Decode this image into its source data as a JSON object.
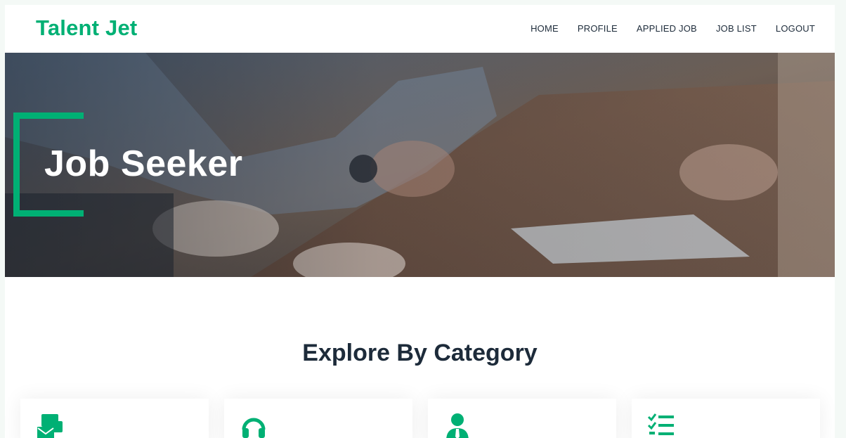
{
  "brand": {
    "name": "Talent Jet"
  },
  "nav": {
    "items": [
      {
        "label": "HOME"
      },
      {
        "label": "PROFILE"
      },
      {
        "label": "APPLIED JOB"
      },
      {
        "label": "JOB LIST"
      },
      {
        "label": "LOGOUT"
      }
    ]
  },
  "hero": {
    "title": "Job Seeker"
  },
  "categories": {
    "title": "Explore By Category",
    "cards": [
      {
        "icon": "mail-check-icon"
      },
      {
        "icon": "headset-icon"
      },
      {
        "icon": "user-tie-icon"
      },
      {
        "icon": "tasks-list-icon"
      }
    ]
  },
  "colors": {
    "accent": "#00b074",
    "text": "#1d2b3a"
  }
}
